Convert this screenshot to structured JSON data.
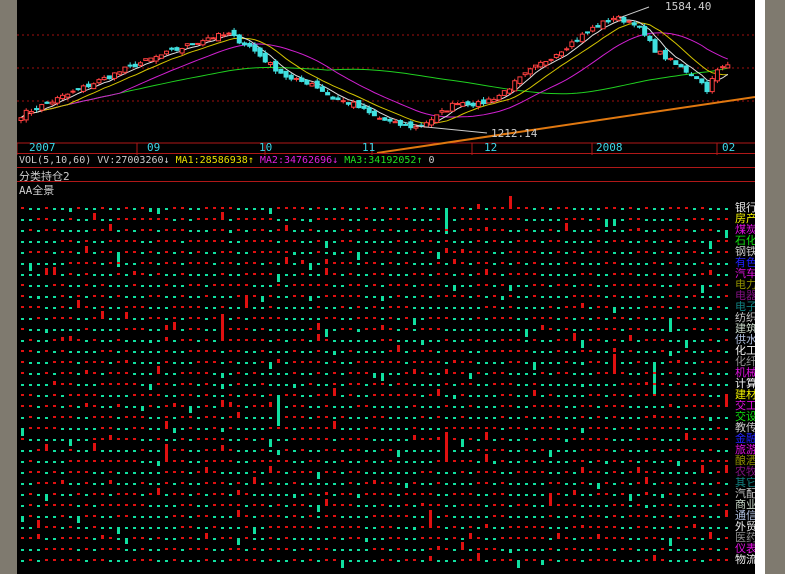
{
  "chart_data": {
    "type": "candlestick",
    "x_labels": [
      "2007",
      "09",
      "10",
      "11",
      "12",
      "2008",
      "02"
    ],
    "high_label": "1584.40",
    "low_label": "1212.14",
    "ylim": [
      1200,
      1600
    ],
    "close_keypoints": [
      [
        0,
        1255
      ],
      [
        6,
        1300
      ],
      [
        14,
        1360
      ],
      [
        22,
        1420
      ],
      [
        30,
        1470
      ],
      [
        36,
        1510
      ],
      [
        40,
        1520
      ],
      [
        44,
        1480
      ],
      [
        48,
        1420
      ],
      [
        52,
        1370
      ],
      [
        56,
        1360
      ],
      [
        60,
        1310
      ],
      [
        64,
        1290
      ],
      [
        68,
        1250
      ],
      [
        72,
        1225
      ],
      [
        76,
        1215
      ],
      [
        80,
        1250
      ],
      [
        84,
        1300
      ],
      [
        88,
        1290
      ],
      [
        92,
        1320
      ],
      [
        98,
        1400
      ],
      [
        104,
        1470
      ],
      [
        110,
        1540
      ],
      [
        114,
        1575
      ],
      [
        118,
        1560
      ],
      [
        122,
        1470
      ],
      [
        126,
        1420
      ],
      [
        130,
        1380
      ],
      [
        132,
        1340
      ],
      [
        134,
        1400
      ],
      [
        136,
        1420
      ]
    ],
    "ma_colors": {
      "ma5": "#e0e0e0",
      "ma10": "#d4c400",
      "ma20": "#d020d0",
      "ma60": "#20d020"
    }
  },
  "volume": {
    "label": "VOL(5,10,60)",
    "vv": "VV:27003260",
    "vv_arrow": "↓",
    "ma1": "MA1:28586938",
    "ma1_arrow": "↑",
    "ma2": "MA2:34762696",
    "ma2_arrow": "↓",
    "ma3": "MA3:34192052",
    "ma3_arrow": "↑",
    "tail": "0"
  },
  "panels": {
    "p1": "分类持仓2",
    "p2": "AA全景"
  },
  "sectors": [
    {
      "n": "银行",
      "c": "#e8e8e8"
    },
    {
      "n": "房产",
      "c": "#f0f000"
    },
    {
      "n": "煤炭",
      "c": "#e010e0"
    },
    {
      "n": "石化",
      "c": "#10e010"
    },
    {
      "n": "钢铁",
      "c": "#c8c8c8"
    },
    {
      "n": "有色",
      "c": "#2020ff"
    },
    {
      "n": "汽车",
      "c": "#e010e0"
    },
    {
      "n": "电力",
      "c": "#909000"
    },
    {
      "n": "电器",
      "c": "#801080"
    },
    {
      "n": "电子",
      "c": "#108080"
    },
    {
      "n": "纺织",
      "c": "#c8c8c8"
    },
    {
      "n": "建筑",
      "c": "#c8d8c8"
    },
    {
      "n": "供水",
      "c": "#b0c0e0"
    },
    {
      "n": "化工",
      "c": "#f0f0f0"
    },
    {
      "n": "化纤",
      "c": "#909090"
    },
    {
      "n": "机械",
      "c": "#e010e0"
    },
    {
      "n": "计算",
      "c": "#f0f0f0"
    },
    {
      "n": "建材",
      "c": "#f0f000"
    },
    {
      "n": "交工",
      "c": "#e010e0"
    },
    {
      "n": "交设",
      "c": "#10e010"
    },
    {
      "n": "教传",
      "c": "#c8c8c8"
    },
    {
      "n": "金融",
      "c": "#2020ff"
    },
    {
      "n": "旅游",
      "c": "#e010e0"
    },
    {
      "n": "酿酒",
      "c": "#909000"
    },
    {
      "n": "农牧",
      "c": "#801080"
    },
    {
      "n": "其它",
      "c": "#108080"
    },
    {
      "n": "汽配",
      "c": "#c8c8c8"
    },
    {
      "n": "商业",
      "c": "#c8d8c8"
    },
    {
      "n": "通信",
      "c": "#b0c0e0"
    },
    {
      "n": "外贸",
      "c": "#f0f0f0"
    },
    {
      "n": "医药",
      "c": "#909090"
    },
    {
      "n": "仪表",
      "c": "#e010e0"
    },
    {
      "n": "物流",
      "c": "#f0f0f0"
    }
  ]
}
